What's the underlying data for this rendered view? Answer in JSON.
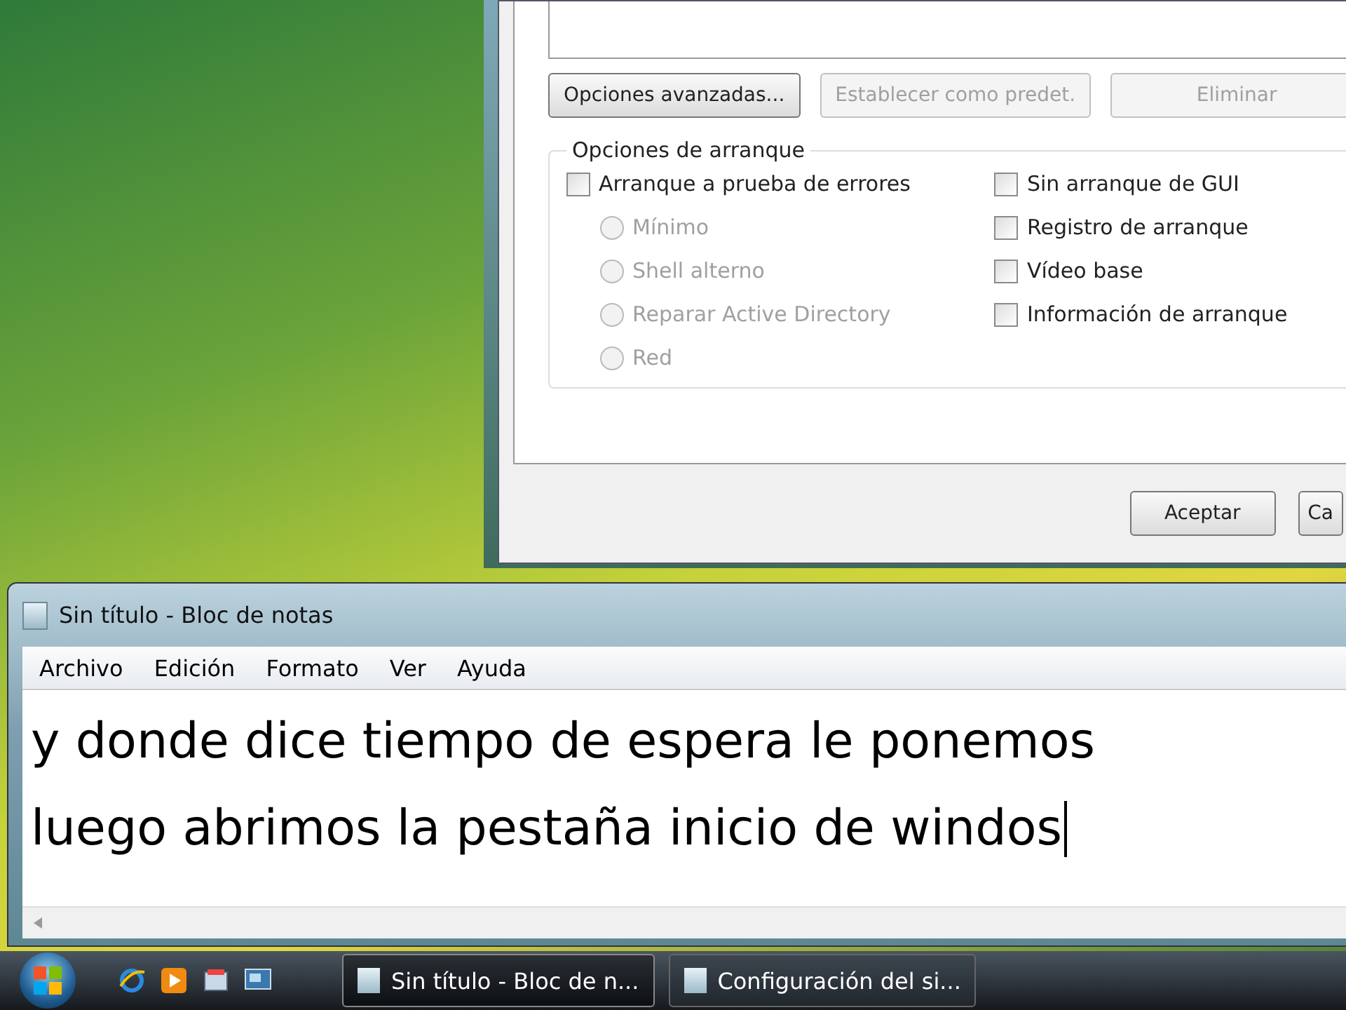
{
  "dialog": {
    "top_buttons": [
      {
        "label": "Opciones avanzadas...",
        "disabled": false
      },
      {
        "label": "Establecer como predet.",
        "disabled": true
      },
      {
        "label": "Eliminar",
        "disabled": true
      }
    ],
    "boot_options": {
      "title": "Opciones de arranque",
      "left": [
        {
          "kind": "checkbox",
          "label": "Arranque a prueba de errores",
          "checked": false,
          "disabled": false
        },
        {
          "kind": "radio",
          "label": "Mínimo",
          "selected": false,
          "disabled": true
        },
        {
          "kind": "radio",
          "label": "Shell alterno",
          "selected": false,
          "disabled": true
        },
        {
          "kind": "radio",
          "label": "Reparar Active Directory",
          "selected": false,
          "disabled": true
        },
        {
          "kind": "radio",
          "label": "Red",
          "selected": false,
          "disabled": true
        }
      ],
      "right": [
        {
          "kind": "checkbox",
          "label": "Sin arranque de GUI",
          "checked": false,
          "disabled": false
        },
        {
          "kind": "checkbox",
          "label": "Registro de arranque",
          "checked": false,
          "disabled": false
        },
        {
          "kind": "checkbox",
          "label": "Vídeo base",
          "checked": false,
          "disabled": false
        },
        {
          "kind": "checkbox",
          "label": "Información de arranque",
          "checked": false,
          "disabled": false
        }
      ]
    },
    "bottom_buttons": [
      {
        "label": "Aceptar"
      },
      {
        "label": "Ca"
      }
    ]
  },
  "notepad": {
    "title": "Sin título - Bloc de notas",
    "menu": [
      "Archivo",
      "Edición",
      "Formato",
      "Ver",
      "Ayuda"
    ],
    "lines": [
      "y donde dice tiempo de espera le ponemos",
      "luego abrimos la pestaña inicio de windos"
    ]
  },
  "taskbar": {
    "tasks": [
      {
        "label": "Sin título - Bloc de n...",
        "selected": true
      },
      {
        "label": "Configuración del si...",
        "selected": false
      }
    ]
  }
}
